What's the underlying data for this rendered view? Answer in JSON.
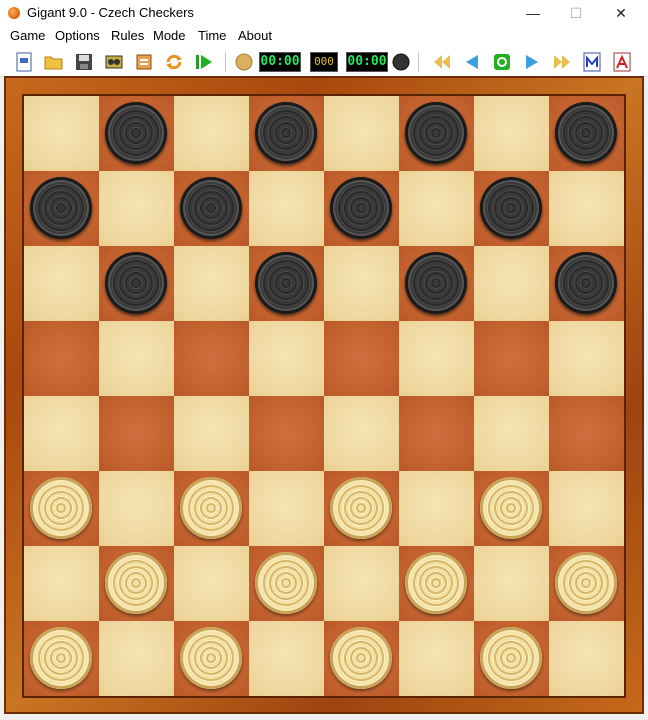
{
  "window": {
    "title": "Gigant 9.0 - Czech Checkers",
    "minimize": "—",
    "maximize": "☐",
    "close": "✕"
  },
  "menu": [
    "Game",
    "Options",
    "Rules",
    "Mode",
    "Time",
    "About"
  ],
  "toolbar": {
    "clock_left": "00:00",
    "move_counter": "000",
    "clock_right": "00:00",
    "icons": [
      "new-game-icon",
      "open-icon",
      "save-icon",
      "engine-icon",
      "print-icon",
      "rotate-board-icon",
      "play-icon",
      "white-side-icon",
      "black-side-icon",
      "first-move-icon",
      "back-move-icon",
      "stop-icon",
      "forward-move-icon",
      "last-move-icon",
      "m-icon",
      "a-icon"
    ]
  },
  "colors": {
    "light_square": "#efd8a0",
    "dark_square": "#c2612d",
    "frame": "#b85a18",
    "clock_digits": "#23e85c"
  },
  "board": {
    "rows": [
      [
        null,
        "b",
        null,
        "b",
        null,
        "b",
        null,
        "b"
      ],
      [
        "b",
        null,
        "b",
        null,
        "b",
        null,
        "b",
        null
      ],
      [
        null,
        "b",
        null,
        "b",
        null,
        "b",
        null,
        "b"
      ],
      [
        null,
        null,
        null,
        null,
        null,
        null,
        null,
        null
      ],
      [
        null,
        null,
        null,
        null,
        null,
        null,
        null,
        null
      ],
      [
        "w",
        null,
        "w",
        null,
        "w",
        null,
        "w",
        null
      ],
      [
        null,
        "w",
        null,
        "w",
        null,
        "w",
        null,
        "w"
      ],
      [
        "w",
        null,
        "w",
        null,
        "w",
        null,
        "w",
        null
      ]
    ]
  }
}
